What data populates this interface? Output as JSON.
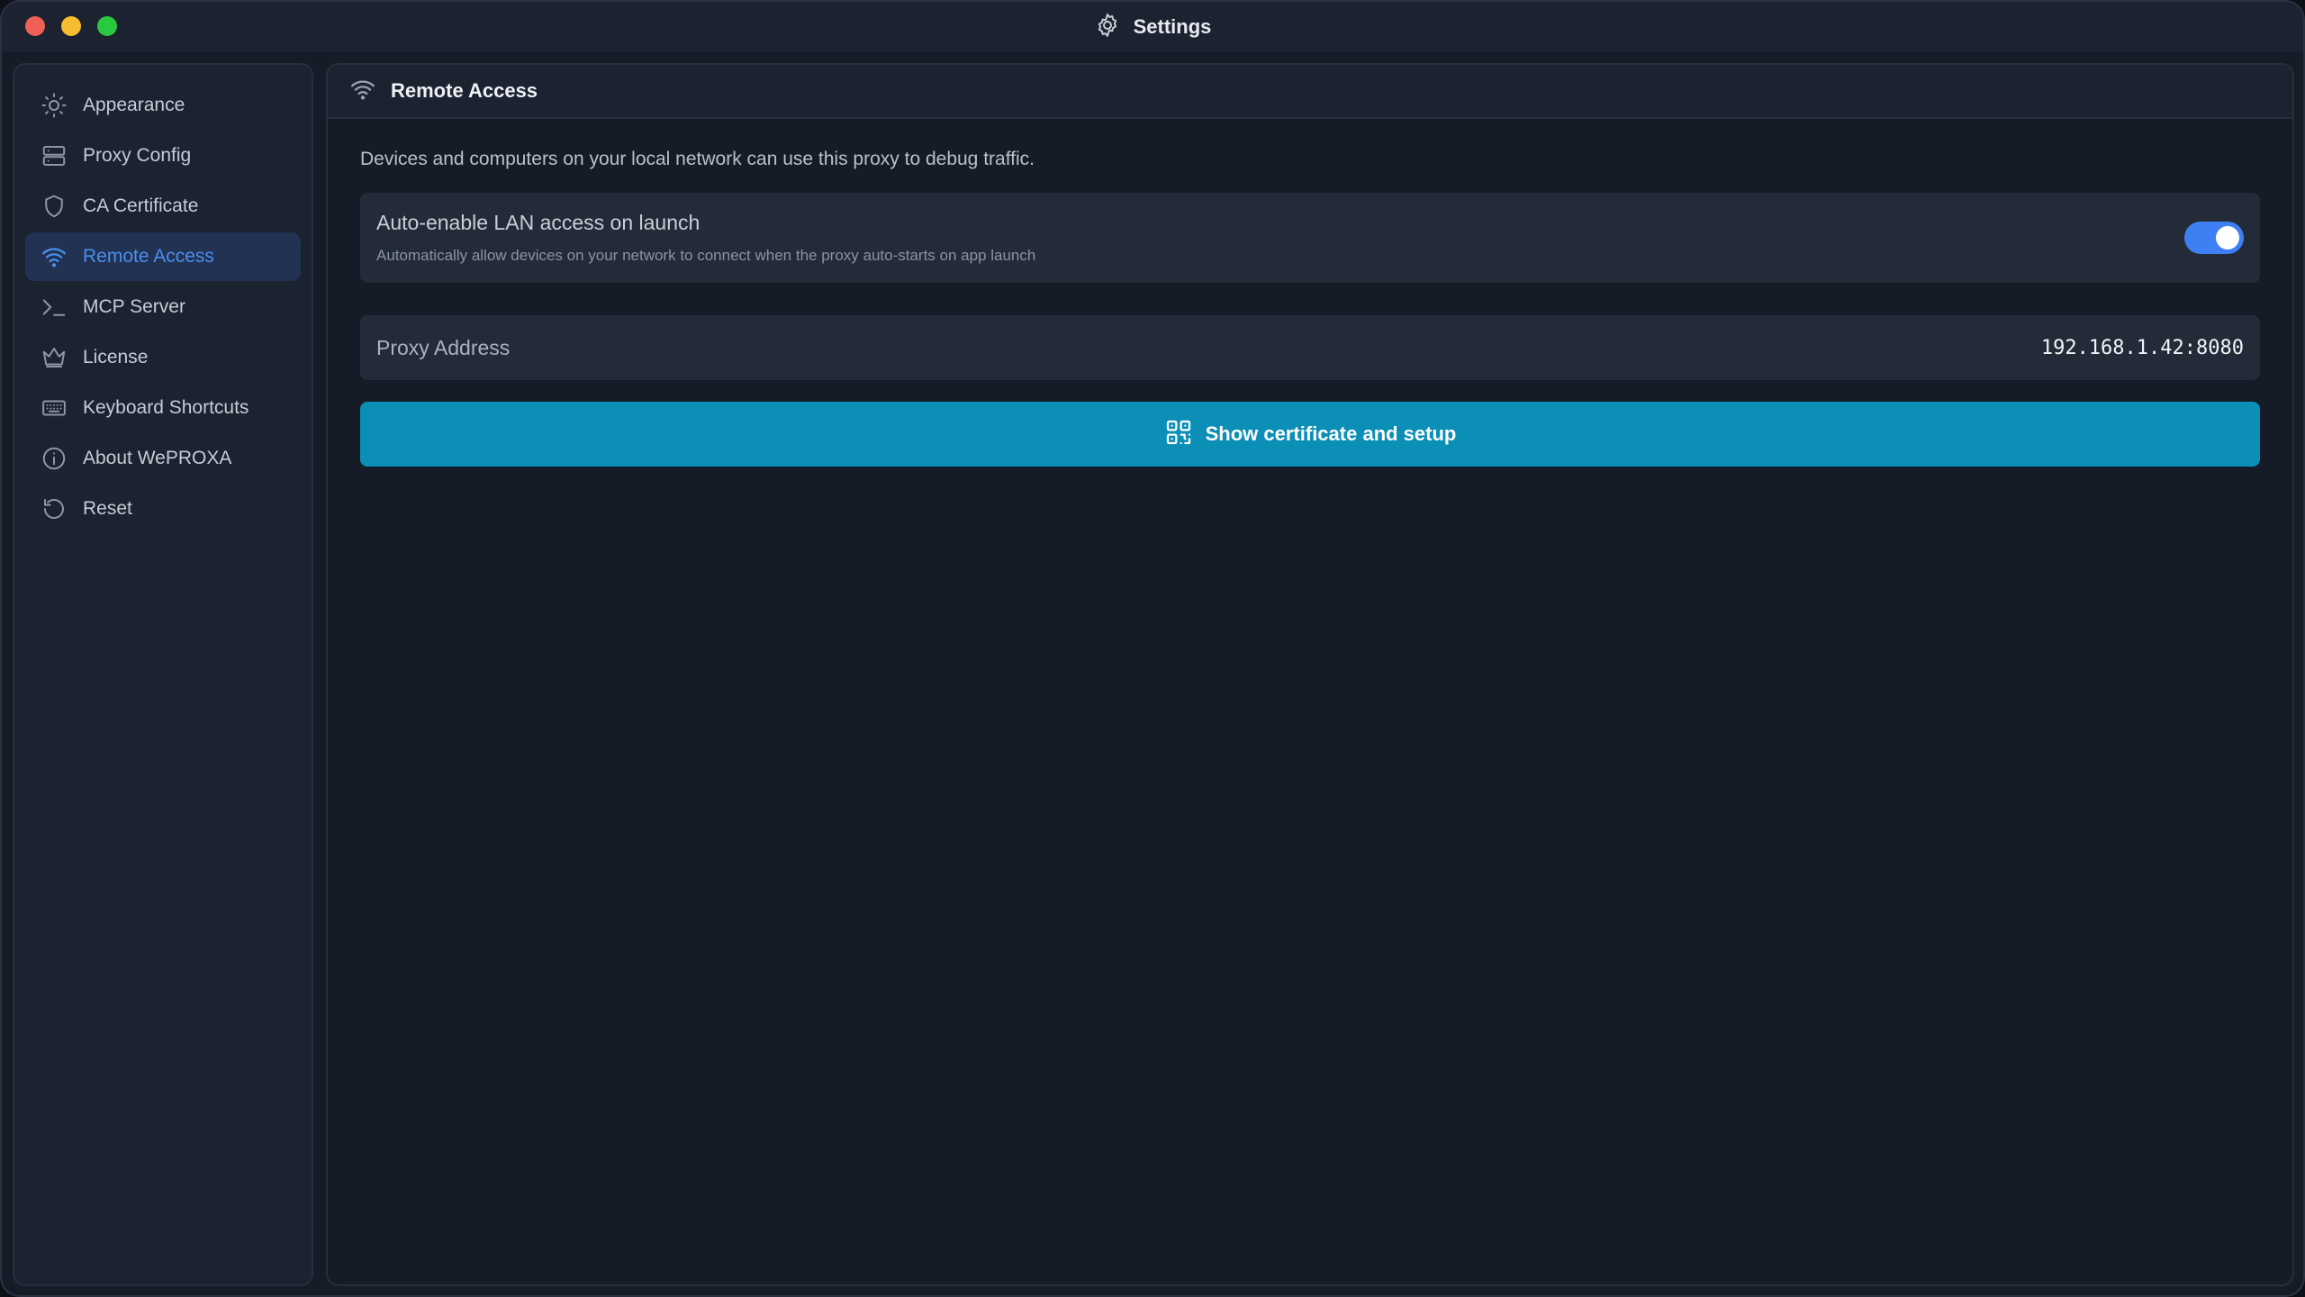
{
  "window": {
    "title": "Settings",
    "title_icon": "gear-icon",
    "traffic_lights": {
      "close_color": "#ee5f57",
      "minimize_color": "#f5bd2f",
      "zoom_color": "#29c840"
    }
  },
  "sidebar": {
    "items": [
      {
        "label": "Appearance",
        "icon": "sun-icon",
        "active": false
      },
      {
        "label": "Proxy Config",
        "icon": "server-icon",
        "active": false
      },
      {
        "label": "CA Certificate",
        "icon": "shield-icon",
        "active": false
      },
      {
        "label": "Remote Access",
        "icon": "wifi-icon",
        "active": true
      },
      {
        "label": "MCP Server",
        "icon": "terminal-icon",
        "active": false
      },
      {
        "label": "License",
        "icon": "crown-icon",
        "active": false
      },
      {
        "label": "Keyboard Shortcuts",
        "icon": "keyboard-icon",
        "active": false
      },
      {
        "label": "About WePROXA",
        "icon": "info-icon",
        "active": false
      },
      {
        "label": "Reset",
        "icon": "reset-icon",
        "active": false
      }
    ]
  },
  "main": {
    "header_title": "Remote Access",
    "header_icon": "wifi-icon",
    "description": "Devices and computers on your local network can use this proxy to debug traffic.",
    "lan_toggle": {
      "title": "Auto-enable LAN access on launch",
      "subtitle": "Automatically allow devices on your network to connect when the proxy auto-starts on app launch",
      "enabled": true
    },
    "proxy_address": {
      "label": "Proxy Address",
      "value": "192.168.1.42:8080"
    },
    "setup_button": {
      "label": "Show certificate and setup",
      "icon": "qr-code-icon"
    }
  },
  "colors": {
    "accent": "#3e80f3",
    "active_nav_text": "#4a8fef",
    "button_bg": "#0b8fb7"
  }
}
